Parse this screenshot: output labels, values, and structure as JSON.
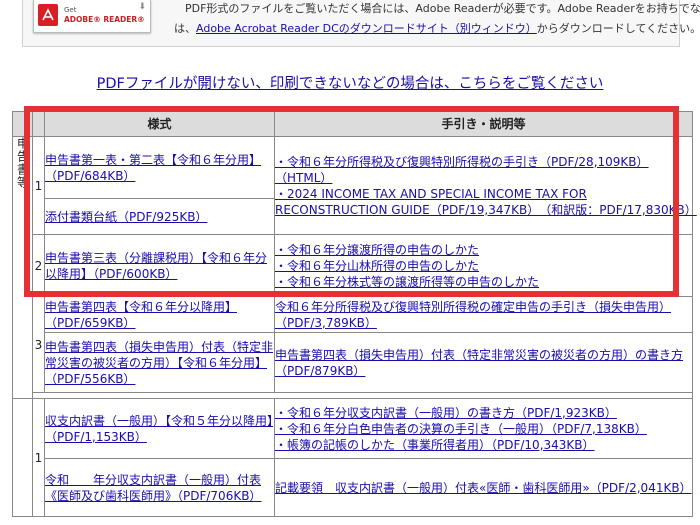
{
  "top": {
    "badge": {
      "get": "Get",
      "reader": "ADOBE® READER®",
      "arrow": "⬇"
    },
    "line1": "PDF形式のファイルをご覧いただく場合には、Adobe Readerが必要です。Adobe Readerをお持ちでない方",
    "line2_pre": "は、",
    "line2_link": "Adobe Acrobat Reader DCのダウンロードサイト（別ウィンドウ）",
    "line2_post": "からダウンロードしてください。"
  },
  "help_link": "PDFファイルが開けない、印刷できないなどの場合は、こちらをご覧ください",
  "table": {
    "header_form": "様式",
    "header_guide": "手引き・説明等",
    "category1": "申告書等",
    "row1": {
      "num": "1",
      "form_a": "申告書第一表・第二表【令和６年分用】（PDF/684KB）",
      "form_b": "添付書類台紙（PDF/925KB）",
      "guides": [
        "・令和６年分所得税及び復興特別所得税の手引き（PDF/28,109KB）（HTML）",
        "・2024 INCOME TAX AND SPECIAL INCOME TAX FOR RECONSTRUCTION GUIDE（PDF/19,347KB）　（和訳版：PDF/17,830KB）"
      ]
    },
    "row2": {
      "num": "2",
      "form": "申告書第三表（分離課税用）【令和６年分以降用】（PDF/600KB）",
      "guides": [
        "・令和６年分譲渡所得の申告のしかた",
        "・令和６年分山林所得の申告のしかた",
        "・令和６年分株式等の譲渡所得等の申告のしかた"
      ]
    },
    "row3": {
      "num": "3",
      "form_a": "申告書第四表【令和６年分以降用】（PDF/659KB）",
      "guide_a": "令和６年分所得税及び復興特別所得税の確定申告の手引き（損失申告用）（PDF/3,789KB）",
      "form_b": "申告書第四表（損失申告用）付表（特定非常災害の被災者の方用）【令和６年分用】（PDF/556KB）",
      "guide_b": "申告書第四表（損失申告用）付表（特定非常災害の被災者の方用）の書き方（PDF/879KB）"
    },
    "row4": {
      "num": "1",
      "form_a": "収支内訳書（一般用）【令和５年分以降用】（PDF/1,153KB）",
      "guides_a": [
        "・令和６年分収支内訳書（一般用）の書き方（PDF/1,923KB）",
        "・令和６年分白色申告者の決算の手引き（一般用）（PDF/7,138KB）",
        "・帳簿の記帳のしかた（事業所得者用）（PDF/10,343KB）"
      ],
      "form_b": "令和　　年分収支内訳書（一般用）付表《医師及び歯科医師用》（PDF/706KB）",
      "guide_b": "記載要領　収支内訳書（一般用）付表«医師・歯科医師用»（PDF/2,041KB）"
    }
  },
  "colors": {
    "highlight": "#e63134",
    "link": "#1a0dab",
    "header_bg": "#dcdcdc"
  }
}
